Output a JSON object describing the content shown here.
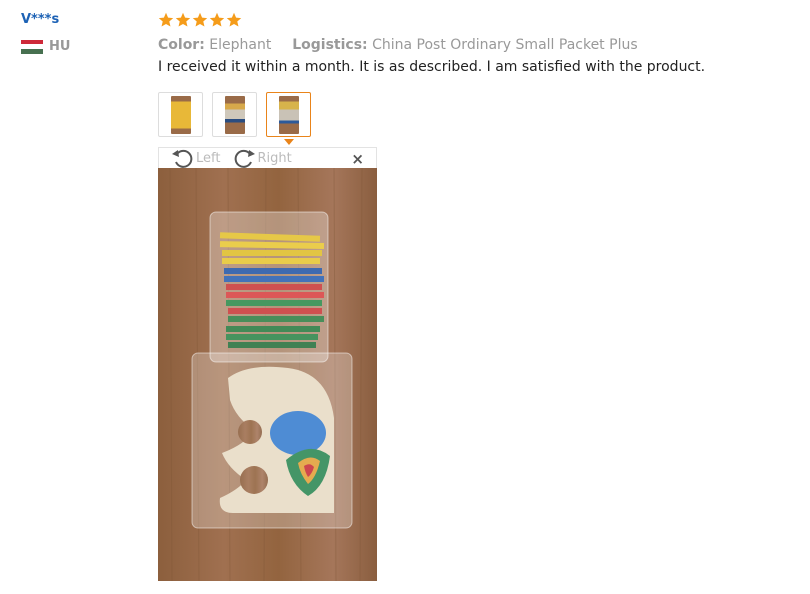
{
  "user": {
    "name": "V***s",
    "country_code": "HU",
    "flag_colors": [
      "#ce2939",
      "#ffffff",
      "#477050"
    ]
  },
  "review": {
    "rating": 5,
    "star_color": "#f59c1a",
    "color_label": "Color:",
    "color_value": "Elephant",
    "logistics_label": "Logistics:",
    "logistics_value": "China Post Ordinary Small Packet Plus",
    "text": "I received it within a month. It is as described. I am satisfied with the product."
  },
  "thumbnails": [
    {
      "name": "thumb-1",
      "color": "#e8b838"
    },
    {
      "name": "thumb-2",
      "color": "#9a6b48"
    },
    {
      "name": "thumb-3",
      "color": "#9a6b48",
      "active": true
    }
  ],
  "viewer": {
    "rotate_left_label": "Left",
    "rotate_right_label": "Right",
    "close_glyph": "×"
  },
  "accent_color": "#e9841a"
}
